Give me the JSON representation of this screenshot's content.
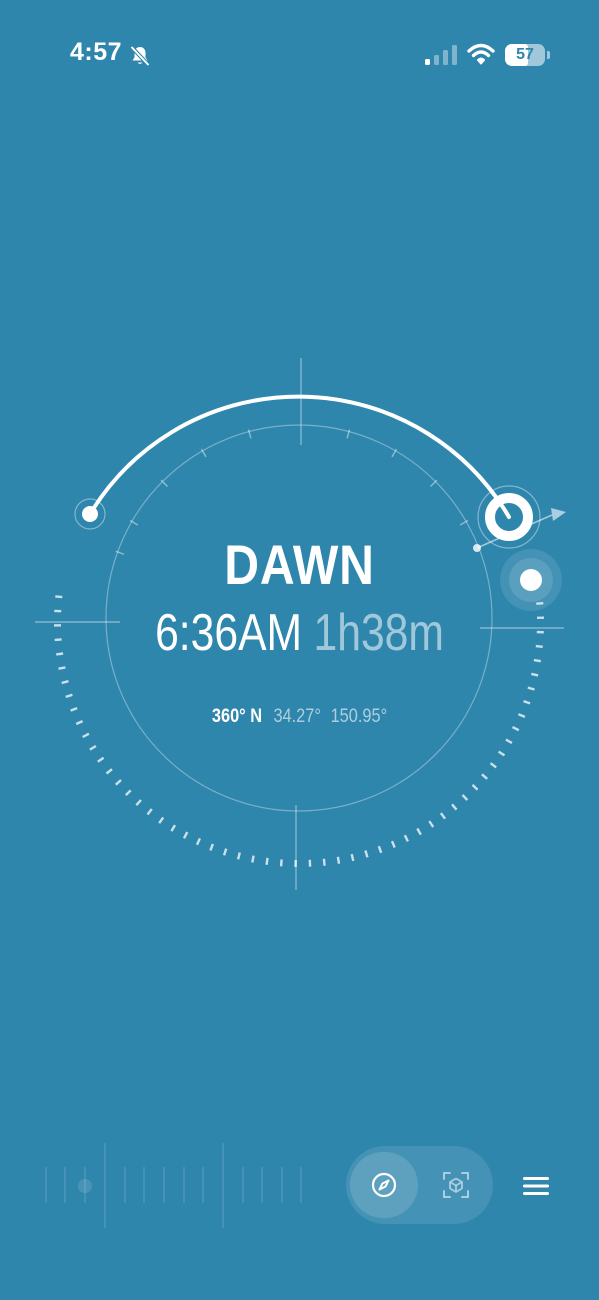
{
  "status_bar": {
    "time": "4:57",
    "battery_percent": 57,
    "battery_label": "57",
    "signal_bars_active": 1,
    "signal_bars_total": 4,
    "icons": [
      "bell-slash-icon",
      "signal-icon",
      "wifi-icon",
      "battery-icon"
    ]
  },
  "phase": {
    "name": "DAWN",
    "time": "6:36AM",
    "duration": "1h38m"
  },
  "location": {
    "heading": "360° N",
    "latitude": "34.27°",
    "longitude": "150.95°"
  },
  "toolbar": {
    "modes": [
      {
        "name": "compass",
        "icon": "compass-icon",
        "active": true
      },
      {
        "name": "ar-view",
        "icon": "ar-cube-icon",
        "active": false
      }
    ],
    "menu_icon": "menu-icon"
  },
  "colors": {
    "background": "#2f86ad",
    "foreground": "#ffffff"
  }
}
